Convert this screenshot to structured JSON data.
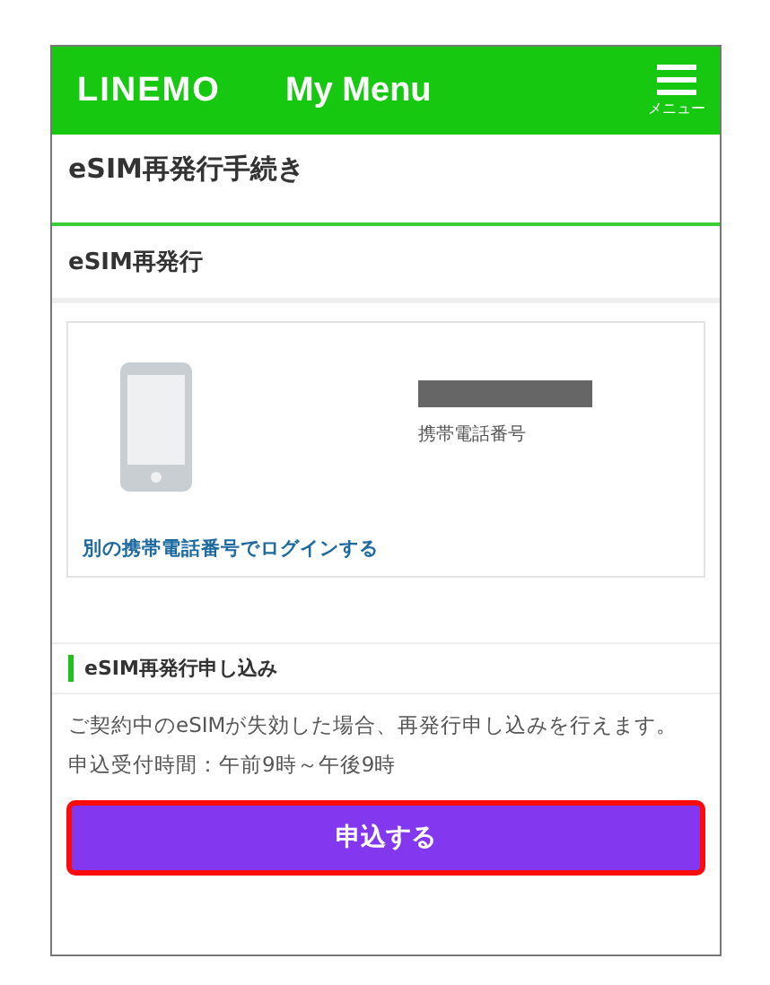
{
  "header": {
    "logo": "LINEMO",
    "title": "My Menu",
    "menu_label": "メニュー"
  },
  "page_title": "eSIM再発行手続き",
  "section_title": "eSIM再発行",
  "account_card": {
    "number_label": "携帯電話番号",
    "number_redacted": true,
    "switch_link": "別の携帯電話番号でログインする"
  },
  "apply_section": {
    "heading": "eSIM再発行申し込み",
    "description": "ご契約中のeSIMが失効した場合、再発行申し込みを行えます。",
    "hours": "申込受付時間：午前9時～午後9時",
    "button": {
      "label": "申込する",
      "highlighted": true
    }
  }
}
